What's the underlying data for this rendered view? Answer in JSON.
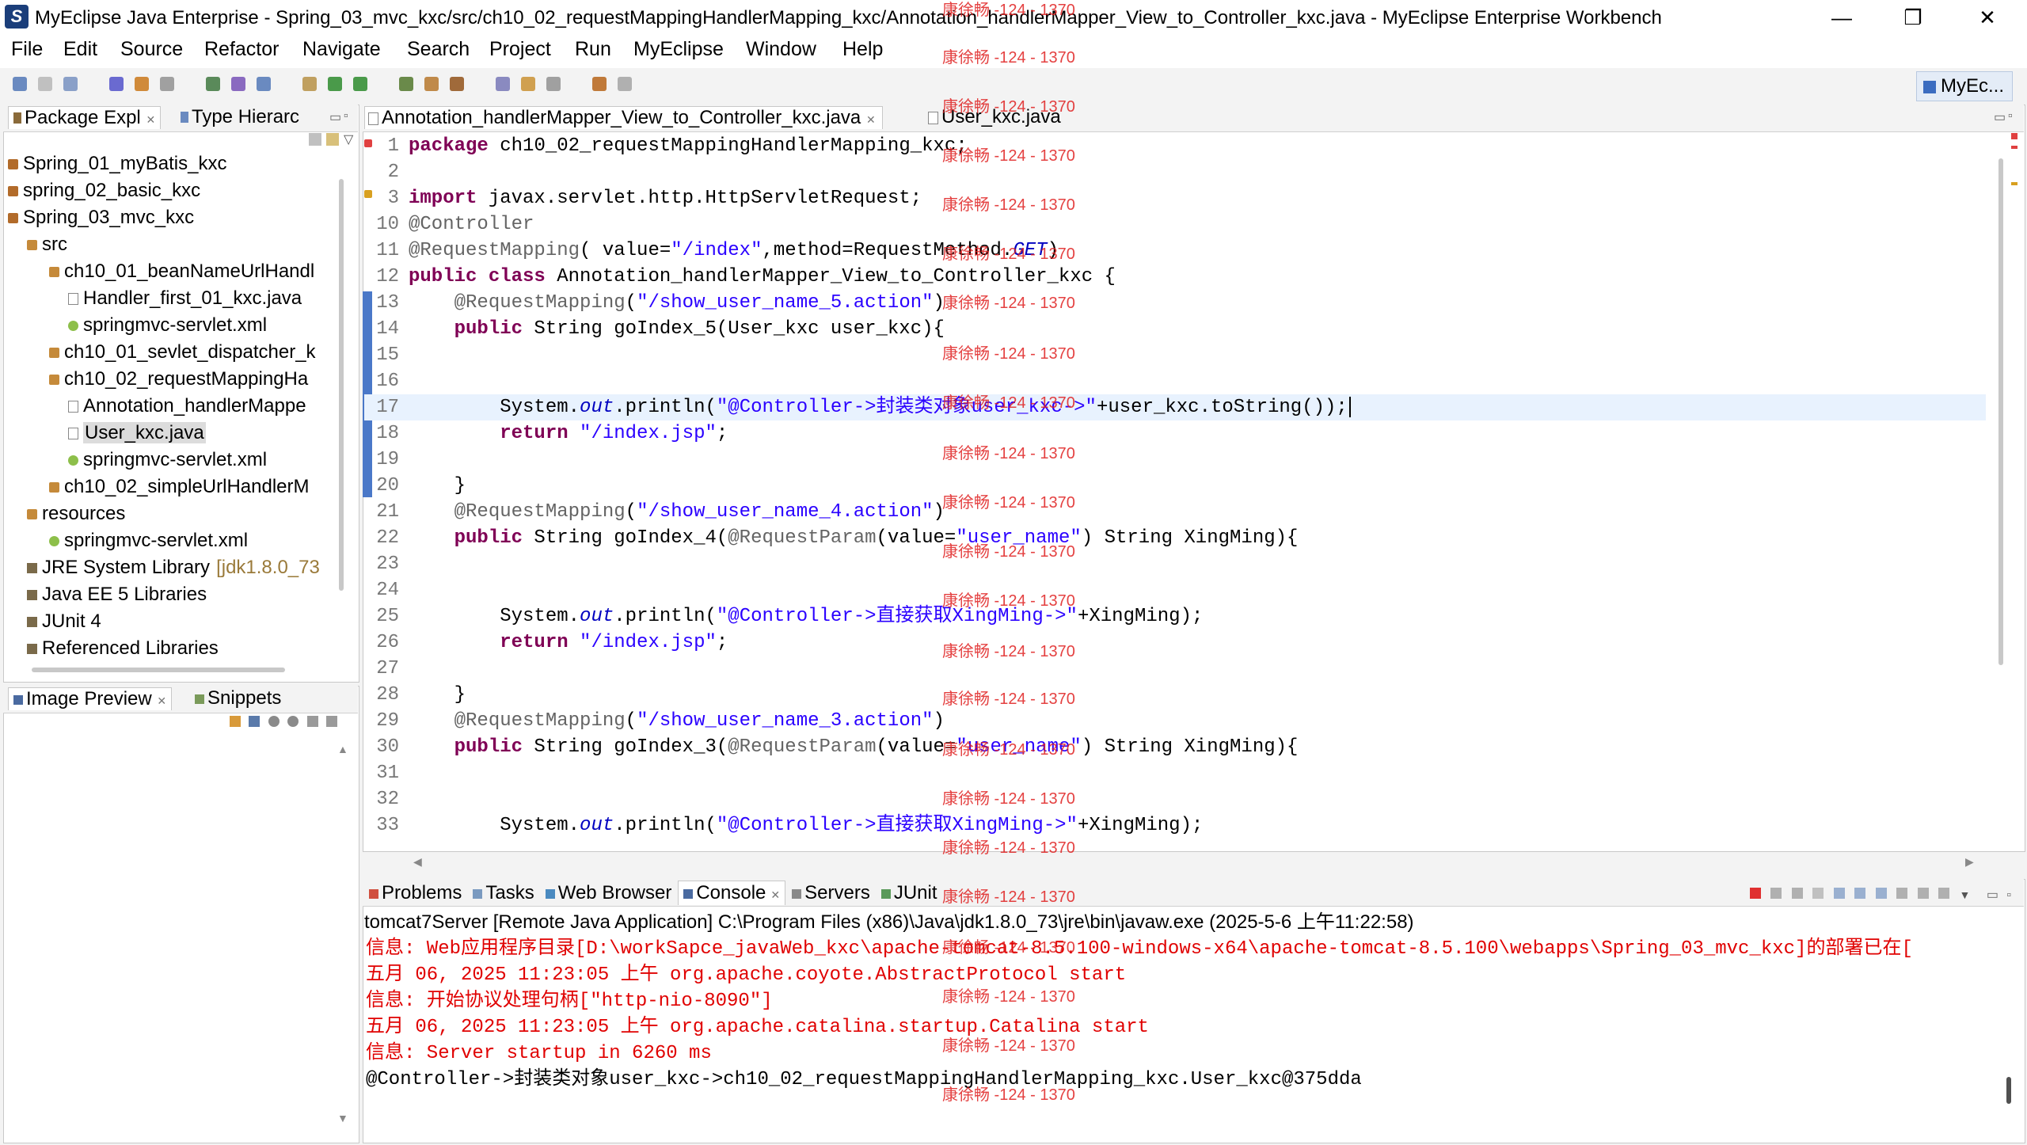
{
  "window": {
    "title": "MyEclipse Java Enterprise - Spring_03_mvc_kxc/src/ch10_02_requestMappingHandlerMapping_kxc/Annotation_handlerMapper_View_to_Controller_kxc.java - MyEclipse Enterprise Workbench",
    "minimize": "—",
    "maximize": "❐",
    "close": "✕"
  },
  "menu": [
    "File",
    "Edit",
    "Source",
    "Refactor",
    "Navigate",
    "Search",
    "Project",
    "Run",
    "MyEclipse",
    "Window",
    "Help"
  ],
  "toolbar": {
    "perspective_label": "MyEc..."
  },
  "left_panel": {
    "tabs": [
      "Package Expl",
      "Type Hierarc"
    ],
    "tree": [
      {
        "label": "Spring_01_myBatis_kxc",
        "indent": 0,
        "icon": "project-icon"
      },
      {
        "label": "spring_02_basic_kxc",
        "indent": 0,
        "icon": "project-icon"
      },
      {
        "label": "Spring_03_mvc_kxc",
        "indent": 0,
        "icon": "project-icon"
      },
      {
        "label": "src",
        "indent": 1,
        "icon": "source-folder-icon"
      },
      {
        "label": "ch10_01_beanNameUrlHandl",
        "indent": 2,
        "icon": "package-icon"
      },
      {
        "label": "Handler_first_01_kxc.java",
        "indent": 3,
        "icon": "java-file-icon"
      },
      {
        "label": "springmvc-servlet.xml",
        "indent": 3,
        "icon": "xml-file-icon"
      },
      {
        "label": "ch10_01_sevlet_dispatcher_k",
        "indent": 2,
        "icon": "package-icon"
      },
      {
        "label": "ch10_02_requestMappingHa",
        "indent": 2,
        "icon": "package-icon"
      },
      {
        "label": "Annotation_handlerMappe",
        "indent": 3,
        "icon": "java-file-icon"
      },
      {
        "label": "User_kxc.java",
        "indent": 3,
        "icon": "java-file-icon",
        "selected": true
      },
      {
        "label": "springmvc-servlet.xml",
        "indent": 3,
        "icon": "xml-file-icon"
      },
      {
        "label": "ch10_02_simpleUrlHandlerM",
        "indent": 2,
        "icon": "package-icon"
      },
      {
        "label": "resources",
        "indent": 1,
        "icon": "source-folder-icon"
      },
      {
        "label": "springmvc-servlet.xml",
        "indent": 2,
        "icon": "xml-file-icon"
      },
      {
        "label": "JRE System Library",
        "extra": "[jdk1.8.0_73",
        "indent": 1,
        "icon": "library-icon"
      },
      {
        "label": "Java EE 5 Libraries",
        "indent": 1,
        "icon": "library-icon"
      },
      {
        "label": "JUnit 4",
        "indent": 1,
        "icon": "library-icon"
      },
      {
        "label": "Referenced Libraries",
        "indent": 1,
        "icon": "library-icon"
      }
    ],
    "bottom_tabs": [
      "Image Preview",
      "Snippets"
    ]
  },
  "editor": {
    "tabs": [
      "Annotation_handlerMapper_View_to_Controller_kxc.java",
      "User_kxc.java"
    ],
    "lines": [
      {
        "n": "1",
        "segs": [
          {
            "t": "package",
            "c": "kw"
          },
          {
            "t": " ch10_02_requestMappingHandlerMapping_kxc;",
            "c": ""
          }
        ]
      },
      {
        "n": "2",
        "segs": []
      },
      {
        "n": "3",
        "segs": [
          {
            "t": "import",
            "c": "kw"
          },
          {
            "t": " javax.servlet.http.HttpServletRequest;",
            "c": ""
          }
        ]
      },
      {
        "n": "10",
        "segs": [
          {
            "t": "@Controller",
            "c": "ann"
          }
        ]
      },
      {
        "n": "11",
        "segs": [
          {
            "t": "@RequestMapping",
            "c": "ann"
          },
          {
            "t": "( value=",
            "c": ""
          },
          {
            "t": "\"/index\"",
            "c": "str"
          },
          {
            "t": ",method=RequestMethod.",
            "c": ""
          },
          {
            "t": "GET",
            "c": "fld"
          },
          {
            "t": ")",
            "c": ""
          }
        ]
      },
      {
        "n": "12",
        "segs": [
          {
            "t": "public class",
            "c": "kw"
          },
          {
            "t": " Annotation_handlerMapper_View_to_Controller_kxc {",
            "c": ""
          }
        ]
      },
      {
        "n": "13",
        "segs": [
          {
            "t": "    @RequestMapping",
            "c": "ann"
          },
          {
            "t": "(",
            "c": ""
          },
          {
            "t": "\"/show_user_name_5.action\"",
            "c": "str"
          },
          {
            "t": ")",
            "c": ""
          }
        ]
      },
      {
        "n": "14",
        "segs": [
          {
            "t": "    public",
            "c": "kw"
          },
          {
            "t": " String goIndex_5(User_kxc user_kxc){",
            "c": ""
          }
        ]
      },
      {
        "n": "15",
        "segs": []
      },
      {
        "n": "16",
        "segs": []
      },
      {
        "n": "17",
        "segs": [
          {
            "t": "        System.",
            "c": ""
          },
          {
            "t": "out",
            "c": "fld"
          },
          {
            "t": ".println(",
            "c": ""
          },
          {
            "t": "\"@Controller->封装类对象user_kxc->\"",
            "c": "str"
          },
          {
            "t": "+user_kxc.toString());",
            "c": ""
          }
        ],
        "current": true
      },
      {
        "n": "18",
        "segs": [
          {
            "t": "        return",
            "c": "kw"
          },
          {
            "t": " ",
            "c": ""
          },
          {
            "t": "\"/index.jsp\"",
            "c": "str"
          },
          {
            "t": ";",
            "c": ""
          }
        ]
      },
      {
        "n": "19",
        "segs": []
      },
      {
        "n": "20",
        "segs": [
          {
            "t": "    }",
            "c": ""
          }
        ]
      },
      {
        "n": "21",
        "segs": [
          {
            "t": "    @RequestMapping",
            "c": "ann"
          },
          {
            "t": "(",
            "c": ""
          },
          {
            "t": "\"/show_user_name_4.action\"",
            "c": "str"
          },
          {
            "t": ")",
            "c": ""
          }
        ]
      },
      {
        "n": "22",
        "segs": [
          {
            "t": "    public",
            "c": "kw"
          },
          {
            "t": " String goIndex_4(",
            "c": ""
          },
          {
            "t": "@RequestParam",
            "c": "ann"
          },
          {
            "t": "(value=",
            "c": ""
          },
          {
            "t": "\"user_name\"",
            "c": "str"
          },
          {
            "t": ") String XingMing){",
            "c": ""
          }
        ]
      },
      {
        "n": "23",
        "segs": []
      },
      {
        "n": "24",
        "segs": []
      },
      {
        "n": "25",
        "segs": [
          {
            "t": "        System.",
            "c": ""
          },
          {
            "t": "out",
            "c": "fld"
          },
          {
            "t": ".println(",
            "c": ""
          },
          {
            "t": "\"@Controller->直接获取XingMing->\"",
            "c": "str"
          },
          {
            "t": "+XingMing);",
            "c": ""
          }
        ]
      },
      {
        "n": "26",
        "segs": [
          {
            "t": "        return",
            "c": "kw"
          },
          {
            "t": " ",
            "c": ""
          },
          {
            "t": "\"/index.jsp\"",
            "c": "str"
          },
          {
            "t": ";",
            "c": ""
          }
        ]
      },
      {
        "n": "27",
        "segs": []
      },
      {
        "n": "28",
        "segs": [
          {
            "t": "    }",
            "c": ""
          }
        ]
      },
      {
        "n": "29",
        "segs": [
          {
            "t": "    @RequestMapping",
            "c": "ann"
          },
          {
            "t": "(",
            "c": ""
          },
          {
            "t": "\"/show_user_name_3.action\"",
            "c": "str"
          },
          {
            "t": ")",
            "c": ""
          }
        ]
      },
      {
        "n": "30",
        "segs": [
          {
            "t": "    public",
            "c": "kw"
          },
          {
            "t": " String goIndex_3(",
            "c": ""
          },
          {
            "t": "@RequestParam",
            "c": "ann"
          },
          {
            "t": "(value=",
            "c": ""
          },
          {
            "t": "\"user_name\"",
            "c": "str"
          },
          {
            "t": ") String XingMing){",
            "c": ""
          }
        ]
      },
      {
        "n": "31",
        "segs": []
      },
      {
        "n": "32",
        "segs": []
      },
      {
        "n": "33",
        "segs": [
          {
            "t": "        System.",
            "c": ""
          },
          {
            "t": "out",
            "c": "fld"
          },
          {
            "t": ".println(",
            "c": ""
          },
          {
            "t": "\"@Controller->直接获取XingMing->\"",
            "c": "str"
          },
          {
            "t": "+XingMing);",
            "c": ""
          }
        ]
      }
    ]
  },
  "watermark": "康徐畅 -124 - 1370",
  "bottom_panel": {
    "tabs": [
      "Problems",
      "Tasks",
      "Web Browser",
      "Console",
      "Servers",
      "JUnit"
    ],
    "active_tab": "Console",
    "header": "tomcat7Server [Remote Java Application] C:\\Program Files (x86)\\Java\\jdk1.8.0_73\\jre\\bin\\javaw.exe (2025-5-6 上午11:22:58)",
    "lines": [
      {
        "text": "信息: Web应用程序目录[D:\\workSapce_javaWeb_kxc\\apache-tomcat-8.5.100-windows-x64\\apache-tomcat-8.5.100\\webapps\\Spring_03_mvc_kxc]的部署已在[",
        "red": true
      },
      {
        "text": "五月 06, 2025 11:23:05 上午 org.apache.coyote.AbstractProtocol start",
        "red": true
      },
      {
        "text": "信息: 开始协议处理句柄[\"http-nio-8090\"]",
        "red": true
      },
      {
        "text": "五月 06, 2025 11:23:05 上午 org.apache.catalina.startup.Catalina start",
        "red": true
      },
      {
        "text": "信息: Server startup in 6260 ms",
        "red": true
      },
      {
        "text": "@Controller->封装类对象user_kxc->ch10_02_requestMappingHandlerMapping_kxc.User_kxc@375dda",
        "red": false
      }
    ]
  },
  "colors": {
    "keyword": "#7f0055",
    "string": "#2a00ff",
    "annotation": "#646464",
    "console_red": "#e00000",
    "watermark": "#e02020"
  }
}
